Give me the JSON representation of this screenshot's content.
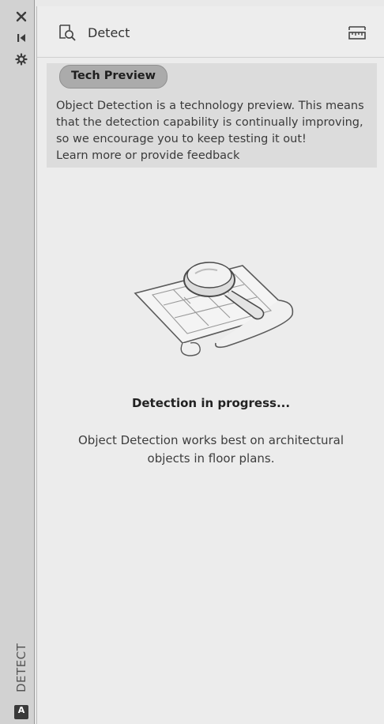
{
  "sidebar": {
    "vertical_label": "DETECT",
    "app_badge": "A",
    "icons": [
      "close-icon",
      "collapse-icon",
      "settings-icon"
    ]
  },
  "header": {
    "title": "Detect",
    "title_icon": "detect-icon",
    "tool_icon": "ruler-icon"
  },
  "tech_preview": {
    "badge": "Tech Preview",
    "message": "Object Detection is a technology preview. This means that the detection capability is continually improving, so we encourage you to keep testing it out!",
    "link": "Learn more or provide feedback"
  },
  "illustration_icon": "magnifier-over-floorplan-icon",
  "status": "Detection in progress...",
  "description": "Object Detection works best on architectural objects in floor plans."
}
